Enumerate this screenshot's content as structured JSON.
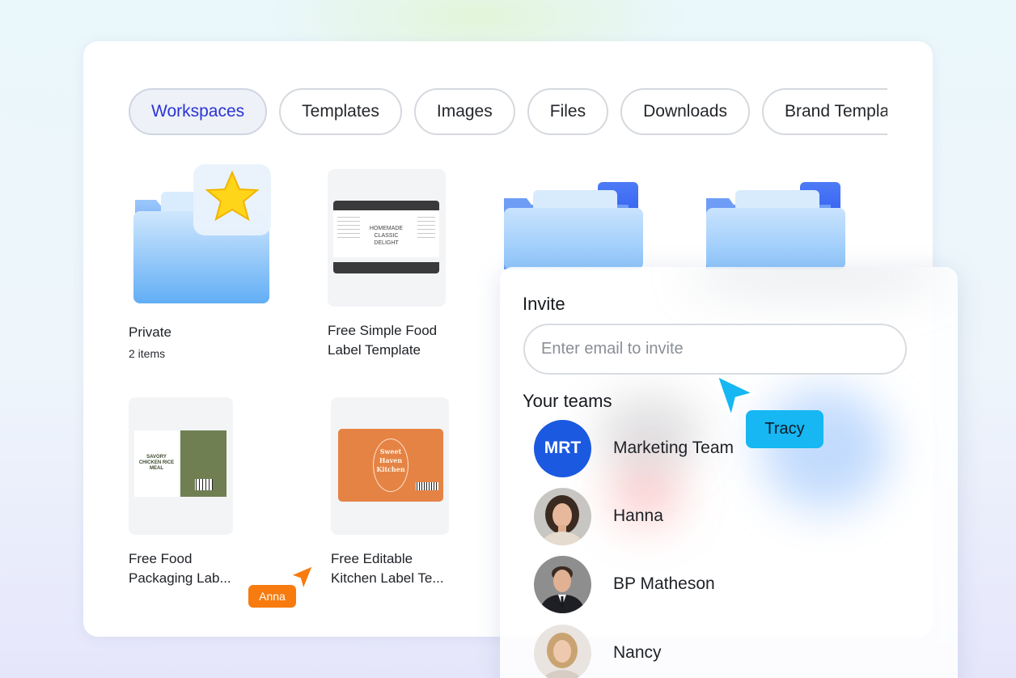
{
  "tabs": [
    {
      "label": "Workspaces",
      "active": true
    },
    {
      "label": "Templates",
      "active": false
    },
    {
      "label": "Images",
      "active": false
    },
    {
      "label": "Files",
      "active": false
    },
    {
      "label": "Downloads",
      "active": false
    },
    {
      "label": "Brand Templates",
      "active": false
    }
  ],
  "items": {
    "private": {
      "title": "Private",
      "subtitle": "2 items"
    },
    "food_label": {
      "title_line1": "Free Simple Food",
      "title_line2": "Label Template",
      "thumb": {
        "line1": "HOMEMADE",
        "line2": "CLASSIC",
        "line3": "DELIGHT"
      }
    },
    "packaging": {
      "title_line1": "Free Food",
      "title_line2": "Packaging Lab...",
      "thumb": {
        "line1": "SAVORY",
        "line2": "CHICKEN RICE",
        "line3": "MEAL"
      }
    },
    "kitchen": {
      "title_line1": "Free Editable",
      "title_line2": "Kitchen Label Te...",
      "thumb": {
        "line1": "Sweet",
        "line2": "Haven",
        "line3": "Kitchen"
      }
    }
  },
  "cursors": {
    "anna": {
      "name": "Anna",
      "color": "#f77b0f"
    },
    "tracy": {
      "name": "Tracy",
      "color": "#16b7f2"
    }
  },
  "invite": {
    "label": "Invite",
    "placeholder": "Enter email to invite",
    "teams_label": "Your teams",
    "teams": [
      {
        "initials": "MRT",
        "name": "Marketing Team",
        "avatar": "initials"
      },
      {
        "initials": "",
        "name": "Hanna",
        "avatar": "photo-female-curly-hair"
      },
      {
        "initials": "",
        "name": "BP Matheson",
        "avatar": "photo-male-suit"
      },
      {
        "initials": "",
        "name": "Nancy",
        "avatar": "photo-female-blonde"
      }
    ]
  },
  "colors": {
    "accent": "#2a33d6",
    "team_avatar": "#1b59e0",
    "folder_light": "#9fd0fb",
    "folder_dark": "#3b66f0"
  }
}
